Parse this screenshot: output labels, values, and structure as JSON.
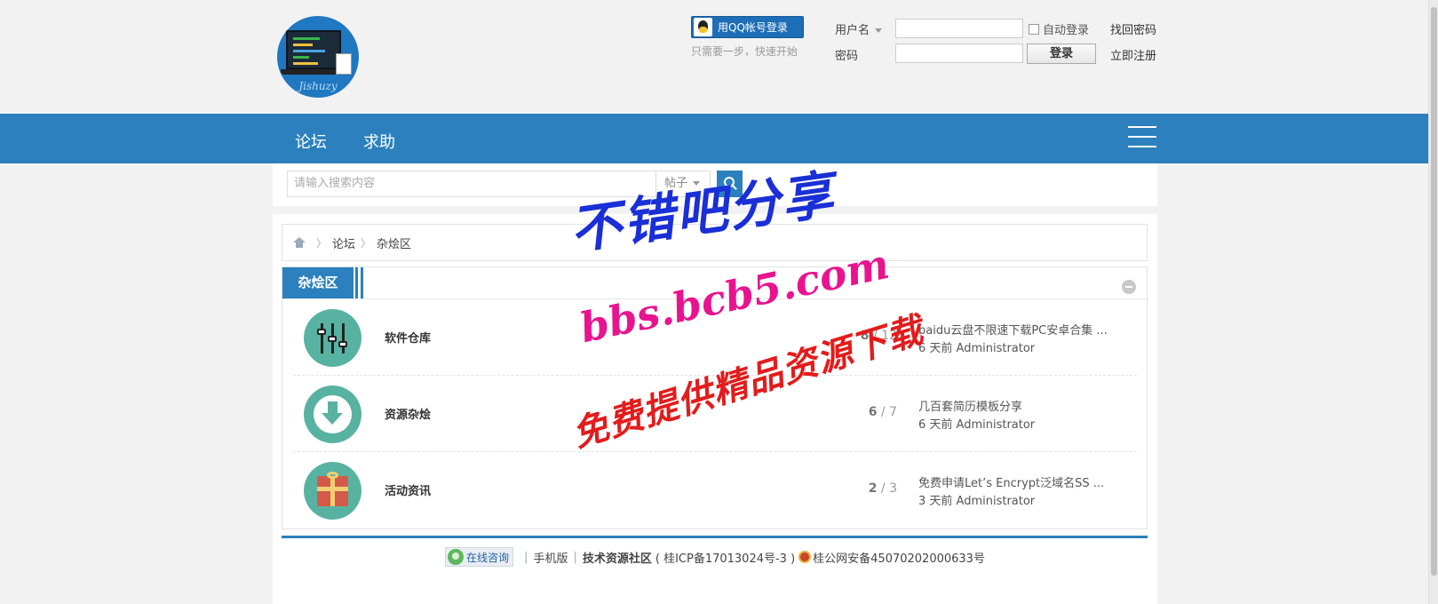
{
  "header": {
    "logo_text": "Jishuzy",
    "qq_login_label": "用QQ帐号登录",
    "qq_hint": "只需要一步，快速开始",
    "username_label": "用户名",
    "password_label": "密码",
    "auto_login_label": "自动登录",
    "login_button": "登录",
    "find_password": "找回密码",
    "register": "立即注册"
  },
  "nav": {
    "items": [
      {
        "label": "论坛"
      },
      {
        "label": "求助"
      }
    ]
  },
  "search": {
    "placeholder": "请输入搜索内容",
    "type_label": "帖子"
  },
  "breadcrumb": {
    "items": [
      "论坛",
      "杂烩区"
    ]
  },
  "board": {
    "title": "杂烩区",
    "forums": [
      {
        "name": "软件仓库",
        "threads": "8",
        "posts": "12",
        "last_title": "baidu云盘不限速下载PC安卓合集 ...",
        "last_meta": "6 天前 Administrator",
        "icon": "sliders-icon"
      },
      {
        "name": "资源杂烩",
        "threads": "6",
        "posts": "7",
        "last_title": "几百套简历模板分享",
        "last_meta": "6 天前 Administrator",
        "icon": "download-arrow-icon"
      },
      {
        "name": "活动资讯",
        "threads": "2",
        "posts": "3",
        "last_title": "免费申请Let’s Encrypt泛域名SS ...",
        "last_meta": "3 天前 Administrator",
        "icon": "gift-icon"
      }
    ]
  },
  "footer": {
    "consult": "在线咨询",
    "mobile": "手机版",
    "site_name": "技术资源社区",
    "icp": "( 桂ICP备17013024号-3 )",
    "police": "桂公网安备45070202000633号"
  },
  "watermark": {
    "line1": "不错吧分享",
    "line2": "bbs.bcb5.com",
    "line3": "免费提供精品资源下载"
  },
  "colors": {
    "brand_blue": "#2b80bd",
    "icon_teal": "#58b2a1",
    "watermark_blue": "#1a2fd6",
    "watermark_pink": "#e8148f",
    "watermark_red": "#e21c1c"
  }
}
